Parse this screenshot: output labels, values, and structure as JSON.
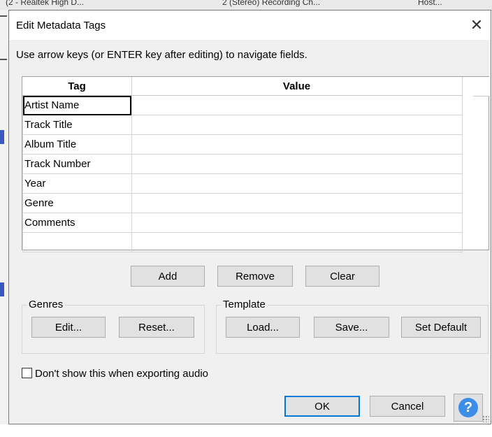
{
  "background": {
    "tabs": [
      "(2 - Realtek High D...",
      "2 (Stereo) Recording Ch...",
      "Host..."
    ]
  },
  "dialog": {
    "title": "Edit Metadata Tags",
    "hint": "Use arrow keys (or ENTER key after editing) to navigate fields.",
    "table": {
      "headers": [
        "Tag",
        "Value"
      ],
      "rows": [
        {
          "tag": "Artist Name",
          "value": ""
        },
        {
          "tag": "Track Title",
          "value": ""
        },
        {
          "tag": "Album Title",
          "value": ""
        },
        {
          "tag": "Track Number",
          "value": ""
        },
        {
          "tag": "Year",
          "value": ""
        },
        {
          "tag": "Genre",
          "value": ""
        },
        {
          "tag": "Comments",
          "value": ""
        },
        {
          "tag": "",
          "value": ""
        }
      ]
    },
    "row_buttons": {
      "add": "Add",
      "remove": "Remove",
      "clear": "Clear"
    },
    "genres": {
      "label": "Genres",
      "edit": "Edit...",
      "reset": "Reset..."
    },
    "template": {
      "label": "Template",
      "load": "Load...",
      "save": "Save...",
      "set_default": "Set Default"
    },
    "checkbox": {
      "label": "Don't show this when exporting audio",
      "checked": false
    },
    "footer": {
      "ok": "OK",
      "cancel": "Cancel",
      "help": "?"
    }
  },
  "colors": {
    "accent": "#0078d7",
    "help_icon": "#3c8ee8"
  }
}
